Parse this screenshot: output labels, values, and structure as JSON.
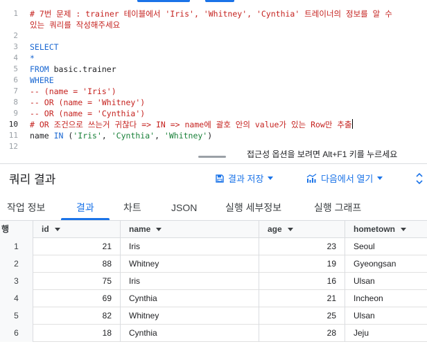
{
  "editor": {
    "lines": [
      {
        "n": "1",
        "parts": [
          {
            "t": "# 7번 문제 : trainer 테이블에서 'Iris', 'Whitney', 'Cynthia' 트레이너의 정보를 알 수",
            "c": "cm"
          }
        ]
      },
      {
        "n": "",
        "parts": [
          {
            "t": "있는 쿼리를 작성해주세요",
            "c": "cm"
          }
        ]
      },
      {
        "n": "2",
        "parts": []
      },
      {
        "n": "3",
        "parts": [
          {
            "t": "SELECT",
            "c": "kw"
          }
        ]
      },
      {
        "n": "4",
        "parts": [
          {
            "t": "*",
            "c": "kw"
          }
        ]
      },
      {
        "n": "5",
        "parts": [
          {
            "t": "FROM",
            "c": "kw"
          },
          {
            "t": " basic.trainer",
            "c": ""
          }
        ]
      },
      {
        "n": "6",
        "parts": [
          {
            "t": "WHERE",
            "c": "kw"
          }
        ]
      },
      {
        "n": "7",
        "parts": [
          {
            "t": "-- (name = 'Iris')",
            "c": "cm"
          }
        ]
      },
      {
        "n": "8",
        "parts": [
          {
            "t": "-- OR (name = 'Whitney')",
            "c": "cm"
          }
        ]
      },
      {
        "n": "9",
        "parts": [
          {
            "t": "-- OR (name = 'Cynthia')",
            "c": "cm"
          }
        ]
      },
      {
        "n": "10",
        "parts": [
          {
            "t": "# OR 조건으로 쓰는거 귀찮다 => IN => name에 괄호 안의 value가 있는 Row만 추출",
            "c": "cm"
          }
        ],
        "active": true
      },
      {
        "n": "11",
        "parts": [
          {
            "t": "name ",
            "c": ""
          },
          {
            "t": "IN",
            "c": "kw"
          },
          {
            "t": " (",
            "c": ""
          },
          {
            "t": "'Iris'",
            "c": "str"
          },
          {
            "t": ", ",
            "c": ""
          },
          {
            "t": "'Cynthia'",
            "c": "str"
          },
          {
            "t": ", ",
            "c": ""
          },
          {
            "t": "'Whitney'",
            "c": "str"
          },
          {
            "t": ")",
            "c": ""
          }
        ]
      },
      {
        "n": "12",
        "parts": []
      }
    ],
    "a11y_hint": "접근성 옵션을 보려면 Alt+F1 키를 누르세요"
  },
  "results": {
    "title": "쿼리 결과",
    "save_label": "결과 저장",
    "explore_label": "다음에서 열기"
  },
  "tabs": [
    {
      "label": "작업 정보",
      "active": false
    },
    {
      "label": "결과",
      "active": true
    },
    {
      "label": "차트",
      "active": false
    },
    {
      "label": "JSON",
      "active": false
    },
    {
      "label": "실행 세부정보",
      "active": false
    },
    {
      "label": "실행 그래프",
      "active": false
    }
  ],
  "table": {
    "row_header": "행",
    "columns": [
      "id",
      "name",
      "age",
      "hometown"
    ],
    "rows": [
      {
        "idx": "1",
        "id": "21",
        "name": "Iris",
        "age": "23",
        "hometown": "Seoul"
      },
      {
        "idx": "2",
        "id": "88",
        "name": "Whitney",
        "age": "19",
        "hometown": "Gyeongsan"
      },
      {
        "idx": "3",
        "id": "75",
        "name": "Iris",
        "age": "16",
        "hometown": "Ulsan"
      },
      {
        "idx": "4",
        "id": "69",
        "name": "Cynthia",
        "age": "21",
        "hometown": "Incheon"
      },
      {
        "idx": "5",
        "id": "82",
        "name": "Whitney",
        "age": "25",
        "hometown": "Ulsan"
      },
      {
        "idx": "6",
        "id": "18",
        "name": "Cynthia",
        "age": "28",
        "hometown": "Jeju"
      }
    ]
  },
  "colors": {
    "accent": "#1a73e8",
    "keyword": "#1967d2",
    "comment": "#c5221f",
    "string": "#188038"
  }
}
